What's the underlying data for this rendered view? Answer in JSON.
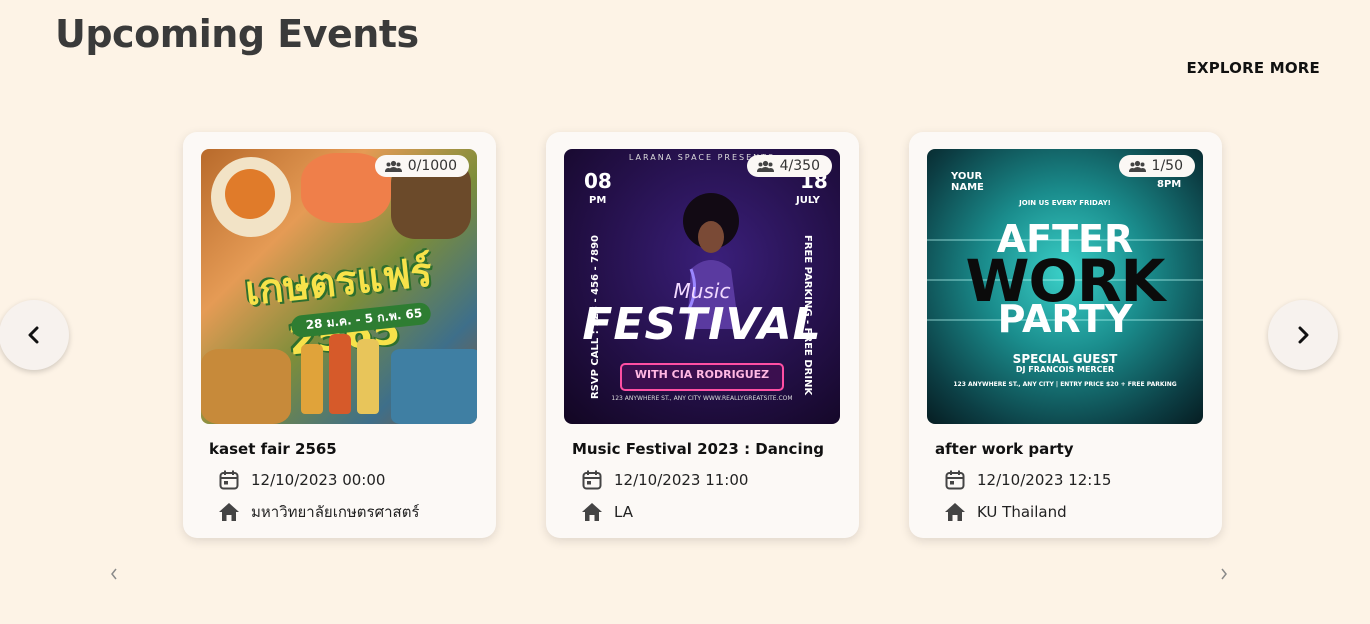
{
  "header": {
    "title": "Upcoming Events",
    "explore_label": "EXPLORE MORE"
  },
  "icons": {
    "people": "people-icon",
    "calendar": "calendar-icon",
    "location": "home-icon",
    "prev": "chevron-left-icon",
    "next": "chevron-right-icon"
  },
  "events": [
    {
      "title": "kaset fair 2565",
      "capacity": "0/1000",
      "date": "12/10/2023 00:00",
      "location": "มหาวิทยาลัยเกษตรศาสตร์",
      "poster": {
        "headline": "เกษตรแฟร์ 2565",
        "dates": "28 ม.ค. - 5 ก.พ. 65"
      }
    },
    {
      "title": "Music Festival 2023 : Dancing",
      "capacity": "4/350",
      "date": "12/10/2023 11:00",
      "location": "LA",
      "poster": {
        "top": "LARANA SPACE PRESENTS",
        "time": "08",
        "time_suffix": "PM",
        "day": "18",
        "month": "JULY",
        "script": "Music",
        "headline": "FESTIVAL",
        "with": "WITH CIA RODRIGUEZ",
        "rsvp": "RSVP CALL : 123 - 456 - 7890",
        "perks": "FREE PARKING - FREE DRINK",
        "footer": "123 ANYWHERE ST., ANY CITY    WWW.REALLYGREATSITE.COM"
      }
    },
    {
      "title": "after work party",
      "capacity": "1/50",
      "date": "12/10/2023 12:15",
      "location": "KU Thailand",
      "poster": {
        "name": "YOUR NAME",
        "time": "8PM",
        "join": "JOIN US EVERY FRIDAY!",
        "line1": "AFTER",
        "line2": "WORK",
        "line3": "PARTY",
        "guest": "SPECIAL GUEST",
        "dj": "DJ FRANCOIS MERCER",
        "footer": "123 ANYWHERE ST., ANY CITY | ENTRY PRICE $20 + FREE PARKING"
      }
    }
  ]
}
